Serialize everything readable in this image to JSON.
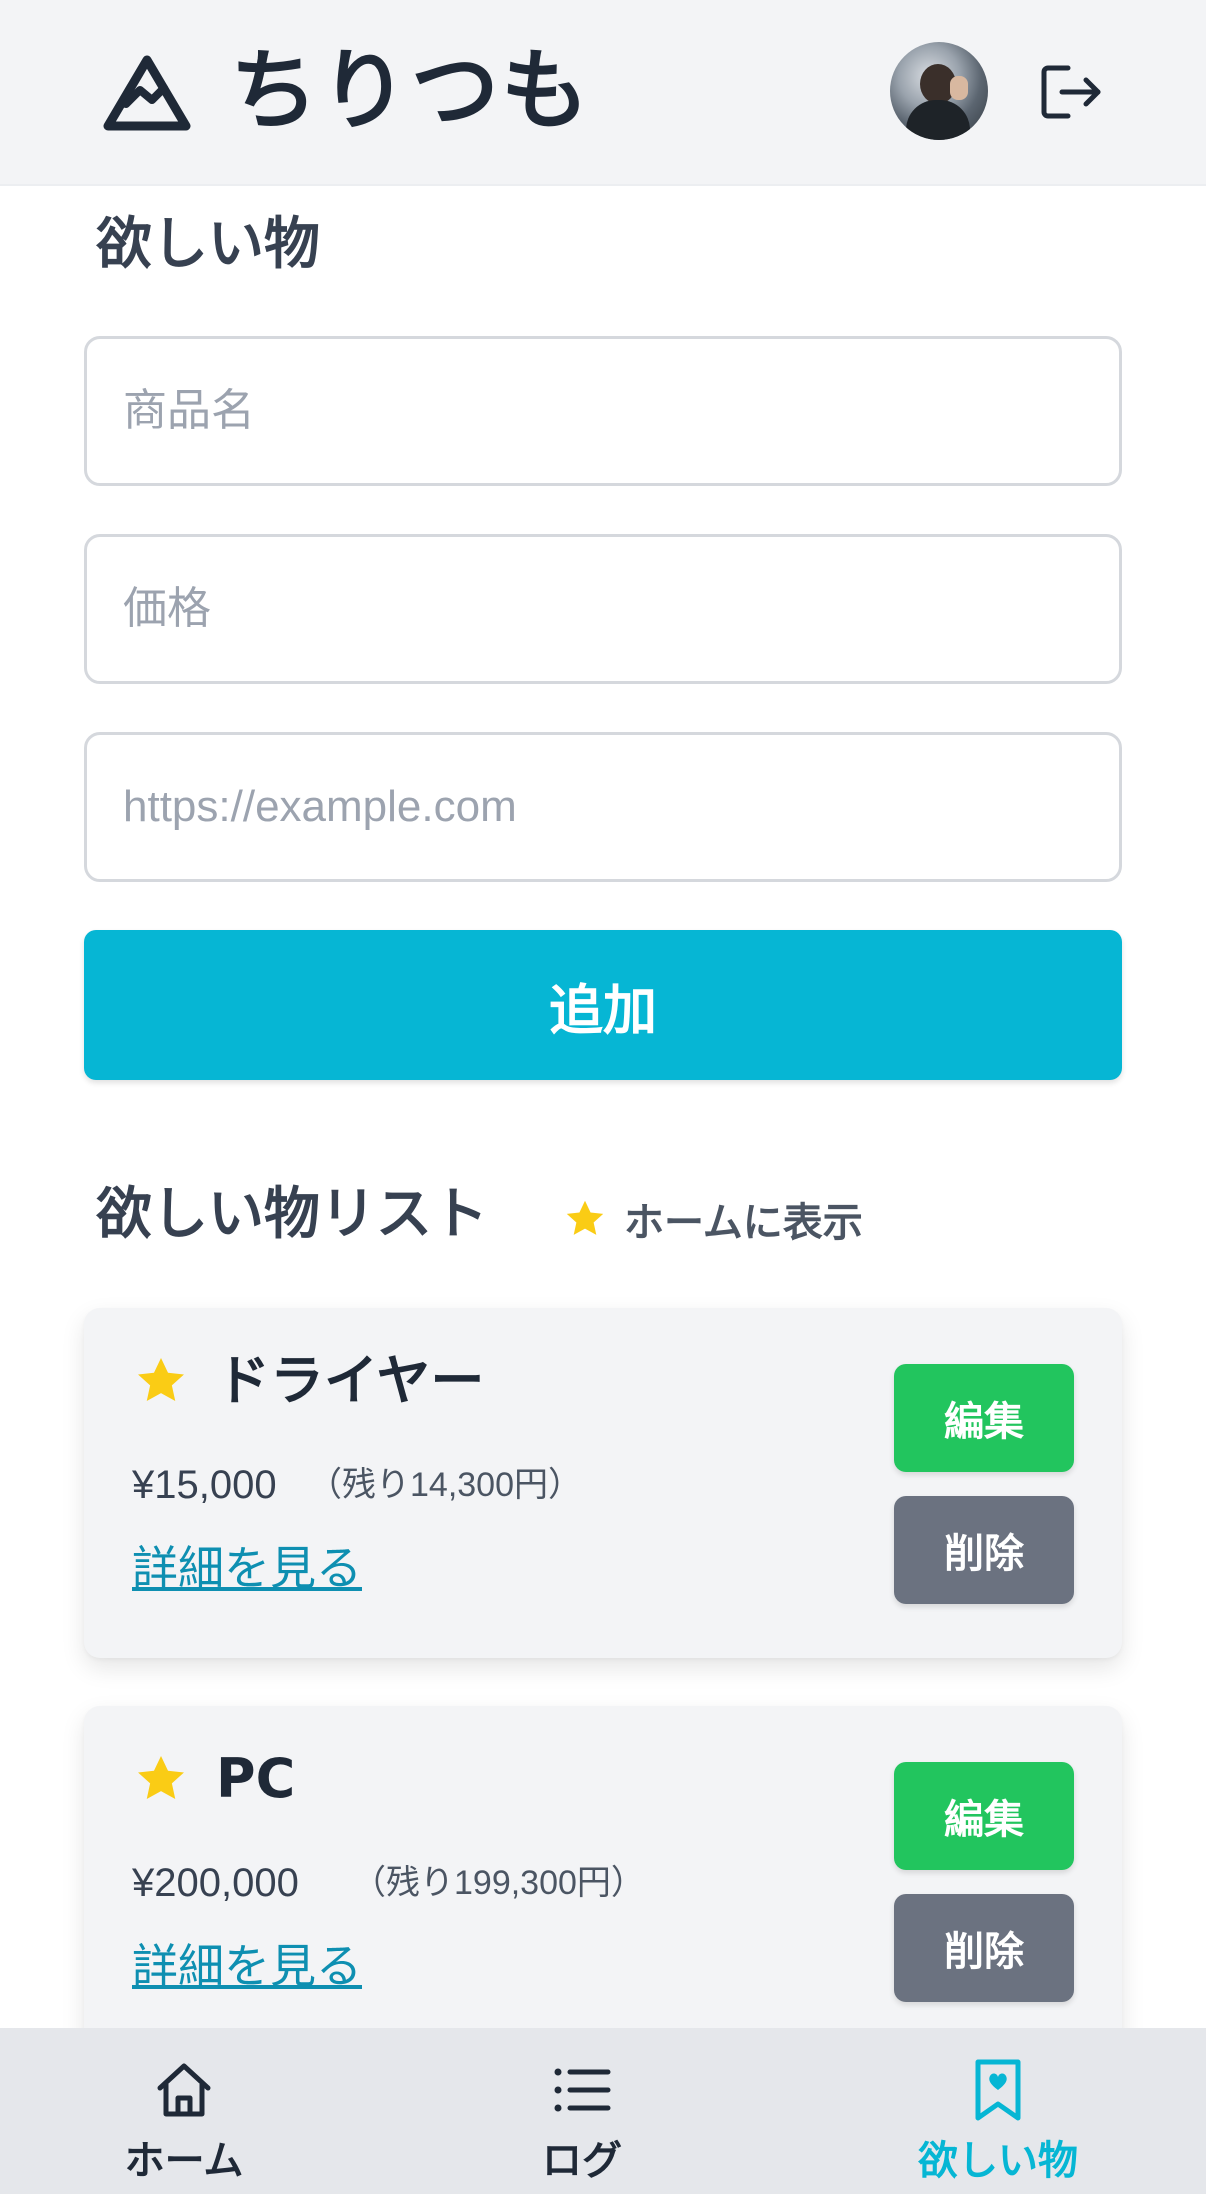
{
  "header": {
    "app_title": "ちりつも"
  },
  "form": {
    "section_title": "欲しい物",
    "product_name_placeholder": "商品名",
    "price_placeholder": "価格",
    "url_placeholder": "https://example.com",
    "add_label": "追加"
  },
  "list": {
    "section_title": "欲しい物リスト",
    "legend_label": "ホームに表示",
    "items": [
      {
        "name": "ドライヤー",
        "price": "¥15,000",
        "remaining": "（残り14,300円）",
        "detail_label": "詳細を見る",
        "edit_label": "編集",
        "delete_label": "削除",
        "starred": true
      },
      {
        "name": "PC",
        "price": "¥200,000",
        "remaining": "（残り199,300円）",
        "detail_label": "詳細を見る",
        "edit_label": "編集",
        "delete_label": "削除",
        "starred": true
      }
    ]
  },
  "bottom_nav": {
    "items": [
      {
        "label": "ホーム",
        "icon": "home-icon",
        "active": false
      },
      {
        "label": "ログ",
        "icon": "list-icon",
        "active": false
      },
      {
        "label": "欲しい物",
        "icon": "bookmark-heart-icon",
        "active": true
      }
    ]
  },
  "colors": {
    "accent": "#06b6d4",
    "edit": "#22c55e",
    "delete": "#6b7280",
    "star": "#facc15",
    "link": "#0e8fb1"
  }
}
